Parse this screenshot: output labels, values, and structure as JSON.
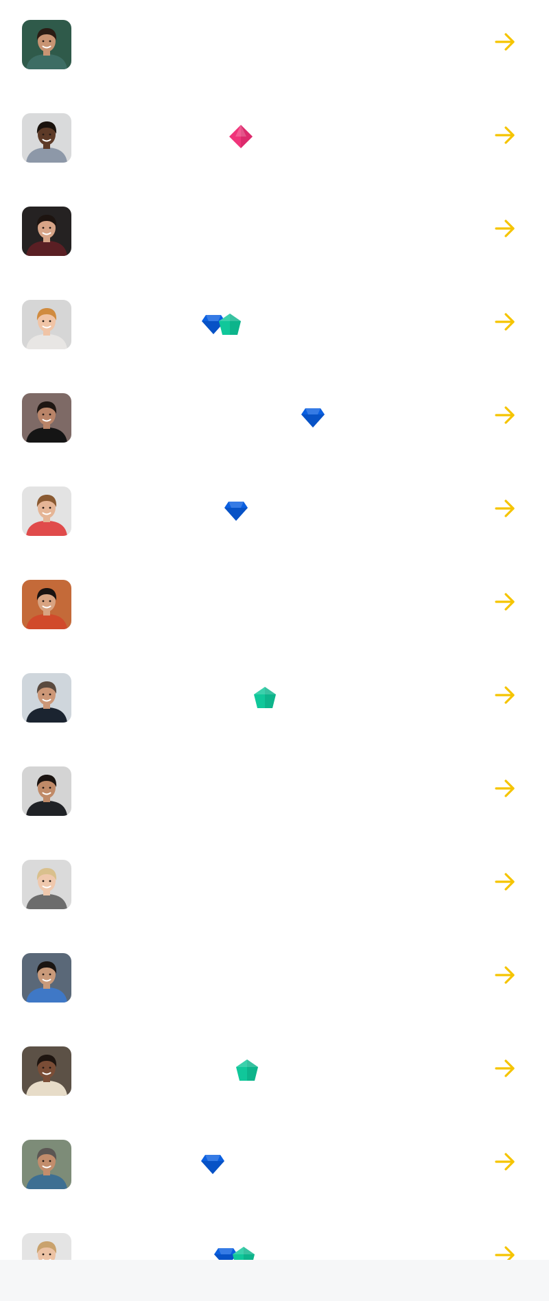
{
  "colors": {
    "arrow": "#f5c400",
    "gem_blue": "#0a5fe0",
    "gem_blue_dark": "#0647b0",
    "gem_teal": "#10c79a",
    "gem_teal_dark": "#0a9e7a",
    "gem_pink": "#f0347a",
    "gem_pink_dark": "#c81f5d"
  },
  "rows": [
    {
      "avatar": "avatar-1",
      "skin": "#c89473",
      "hair": "#2a1c14",
      "shirt": "#3d6d64",
      "bg": "#2f5a4a",
      "gems": [],
      "arrow": "arrow-right-icon"
    },
    {
      "avatar": "avatar-2",
      "skin": "#5d3a27",
      "hair": "#1a120d",
      "shirt": "#8d98a8",
      "bg": "#d9dadb",
      "gems": [
        "pink"
      ],
      "arrow": "arrow-right-icon"
    },
    {
      "avatar": "avatar-3",
      "skin": "#d7a487",
      "hair": "#1d1410",
      "shirt": "#5a1f24",
      "bg": "#252222",
      "gems": [],
      "arrow": "arrow-right-icon"
    },
    {
      "avatar": "avatar-4",
      "skin": "#f0c4a6",
      "hair": "#d08b3f",
      "shirt": "#e8e6e4",
      "bg": "#d6d6d6",
      "gems": [
        "blue",
        "teal"
      ],
      "arrow": "arrow-right-icon"
    },
    {
      "avatar": "avatar-5",
      "skin": "#b98468",
      "hair": "#1e1612",
      "shirt": "#151515",
      "bg": "#7e6a66",
      "gems": [
        "blue"
      ],
      "arrow": "arrow-right-icon"
    },
    {
      "avatar": "avatar-6",
      "skin": "#e5b596",
      "hair": "#8a5a32",
      "shirt": "#e04b4b",
      "bg": "#e3e3e3",
      "gems": [
        "blue"
      ],
      "arrow": "arrow-right-icon"
    },
    {
      "avatar": "avatar-7",
      "skin": "#d8a381",
      "hair": "#1a1210",
      "shirt": "#d14a2b",
      "bg": "#c46a39",
      "gems": [],
      "arrow": "arrow-right-icon"
    },
    {
      "avatar": "avatar-8",
      "skin": "#cc9777",
      "hair": "#5a4a3f",
      "shirt": "#1b2430",
      "bg": "#cfd6dc",
      "gems": [
        "teal"
      ],
      "arrow": "arrow-right-icon"
    },
    {
      "avatar": "avatar-9",
      "skin": "#c08a68",
      "hair": "#1b1411",
      "shirt": "#202226",
      "bg": "#d4d4d4",
      "gems": [],
      "arrow": "arrow-right-icon"
    },
    {
      "avatar": "avatar-10",
      "skin": "#efc8ad",
      "hair": "#d9c08d",
      "shirt": "#6c6c6c",
      "bg": "#dadada",
      "gems": [],
      "arrow": "arrow-right-icon"
    },
    {
      "avatar": "avatar-11",
      "skin": "#c99a7a",
      "hair": "#1a1512",
      "shirt": "#3f78c6",
      "bg": "#5a6878",
      "gems": [],
      "arrow": "arrow-right-icon"
    },
    {
      "avatar": "avatar-12",
      "skin": "#7a4d36",
      "hair": "#1e1510",
      "shirt": "#e7dcc8",
      "bg": "#5c5146",
      "gems": [
        "teal"
      ],
      "arrow": "arrow-right-icon"
    },
    {
      "avatar": "avatar-13",
      "skin": "#c28d6c",
      "hair": "#5b5653",
      "shirt": "#3d6f92",
      "bg": "#7d8c78",
      "gems": [
        "blue"
      ],
      "arrow": "arrow-right-icon"
    },
    {
      "avatar": "avatar-14",
      "skin": "#ecc2a4",
      "hair": "#c9a26d",
      "shirt": "#d7d7d7",
      "bg": "#e4e4e4",
      "gems": [
        "blue",
        "teal"
      ],
      "arrow": "arrow-right-icon"
    }
  ]
}
